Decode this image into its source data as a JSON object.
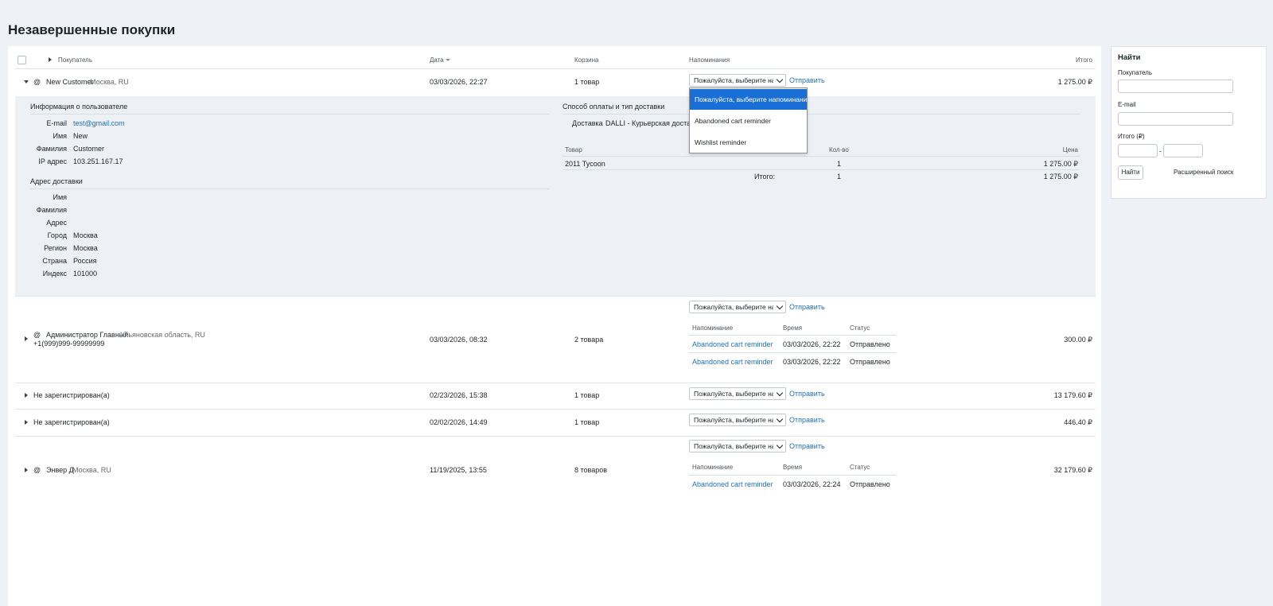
{
  "page_title": "Незавершенные покупки",
  "columns": {
    "buyer": "Покупатель",
    "date": "Дата",
    "cart": "Корзина",
    "reminders": "Напоминания",
    "total": "Итого"
  },
  "reminder_select_placeholder": "Пожалуйста, выберите нап",
  "send_label": "Отправить",
  "dropdown_options": [
    "Пожалуйста, выберите напоминание",
    "Abandoned cart reminder",
    "Wishlist reminder"
  ],
  "rows": [
    {
      "name": "New Customer",
      "location": "Москва, RU",
      "date": "03/03/2026, 22:27",
      "cart": "1 товар",
      "total": "1 275.00 ₽"
    },
    {
      "name": "Администратор Главный",
      "location": "Ульяновская область, RU",
      "phone": "+1(999)999-99999999",
      "date": "03/03/2026, 08:32",
      "cart": "2 товара",
      "total": "300.00 ₽"
    },
    {
      "name": "Не зарегистрирован(а)",
      "date": "02/23/2026, 15:38",
      "cart": "1 товар",
      "total": "13 179.60 ₽"
    },
    {
      "name": "Не зарегистрирован(а)",
      "date": "02/02/2026, 14:49",
      "cart": "1 товар",
      "total": "446.40 ₽"
    },
    {
      "name": "Энвер Д",
      "location": "Москва, RU",
      "date": "11/19/2025, 13:55",
      "cart": "8 товаров",
      "total": "32 179.60 ₽"
    }
  ],
  "details": {
    "user_info_title": "Информация о пользователе",
    "user_fields": [
      {
        "label": "E-mail",
        "value": "test@gmail.com"
      },
      {
        "label": "Имя",
        "value": "New"
      },
      {
        "label": "Фамилия",
        "value": "Customer"
      },
      {
        "label": "IP адрес",
        "value": "103.251.167.17"
      }
    ],
    "shipping_title": "Адрес доставки",
    "shipping_fields": [
      {
        "label": "Имя",
        "value": ""
      },
      {
        "label": "Фамилия",
        "value": ""
      },
      {
        "label": "Адрес",
        "value": ""
      },
      {
        "label": "Город",
        "value": "Москва"
      },
      {
        "label": "Регион",
        "value": "Москва"
      },
      {
        "label": "Страна",
        "value": "Россия"
      },
      {
        "label": "Индекс",
        "value": "101000"
      }
    ],
    "payment_title": "Способ оплаты и тип доставки",
    "delivery_label": "Доставка",
    "delivery_value": "DALLI - Курьерская доставка",
    "items_headers": {
      "product": "Товар",
      "qty": "Кол-во",
      "price": "Цена"
    },
    "item": {
      "product": "2011 Tycoon",
      "qty": "1",
      "price": "1 275.00 ₽"
    },
    "items_total": {
      "label": "Итого:",
      "qty": "1",
      "price": "1 275.00 ₽"
    }
  },
  "history_headers": {
    "reminder": "Напоминание",
    "time": "Время",
    "status": "Статус"
  },
  "history_row2": [
    {
      "reminder": "Abandoned cart reminder",
      "time": "03/03/2026, 22:22",
      "status": "Отправлено"
    },
    {
      "reminder": "Abandoned cart reminder",
      "time": "03/03/2026, 22:22",
      "status": "Отправлено"
    }
  ],
  "history_row5": [
    {
      "reminder": "Abandoned cart reminder",
      "time": "03/03/2026, 22:24",
      "status": "Отправлено"
    }
  ],
  "search_panel": {
    "title": "Найти",
    "buyer_label": "Покупатель",
    "email_label": "E-mail",
    "total_label": "Итого (₽)",
    "range_sep": "-",
    "find_button": "Найти",
    "advanced_link": "Расширенный поиск"
  }
}
